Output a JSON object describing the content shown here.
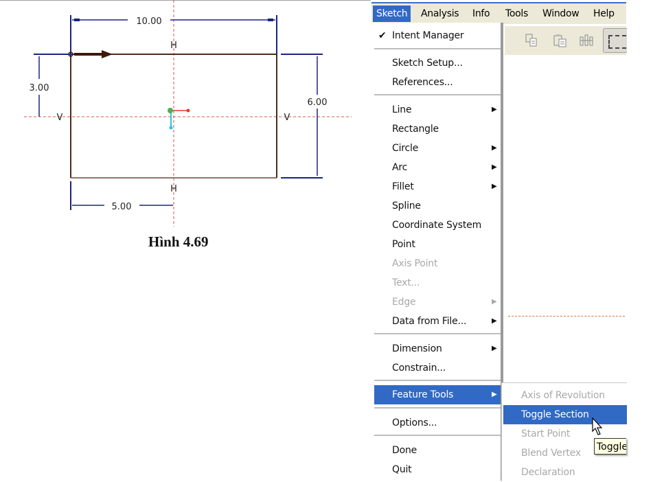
{
  "figure": {
    "caption": "Hình 4.69",
    "dimensions": {
      "top_width": "10.00",
      "left_offset": "3.00",
      "right_height": "6.00",
      "bottom_offset": "5.00"
    },
    "constraint_labels": {
      "h_top": "H",
      "h_bottom": "H",
      "v_left": "V",
      "v_right": "V"
    },
    "colors": {
      "dimension": "#1a237e",
      "geometry": "#4a2a1a",
      "centerline": "#d9534f",
      "coord_x": "#e53935",
      "coord_y": "#26c6da",
      "coord_origin": "#4caf50"
    }
  },
  "menubar": {
    "items": [
      {
        "label": "Sketch",
        "active": true
      },
      {
        "label": "Analysis"
      },
      {
        "label": "Info"
      },
      {
        "label": "Tools"
      },
      {
        "label": "Window"
      },
      {
        "label": "Help"
      }
    ]
  },
  "toolbar": {
    "icons": [
      "copy-icon",
      "paste-icon",
      "paste-special-icon",
      "select-box-icon"
    ]
  },
  "sketch_menu": {
    "items": [
      {
        "label": "Intent Manager",
        "checked": true
      },
      {
        "label": "Sketch Setup..."
      },
      {
        "label": "References..."
      },
      {
        "label": "Line",
        "submenu": true
      },
      {
        "label": "Rectangle"
      },
      {
        "label": "Circle",
        "submenu": true
      },
      {
        "label": "Arc",
        "submenu": true
      },
      {
        "label": "Fillet",
        "submenu": true
      },
      {
        "label": "Spline"
      },
      {
        "label": "Coordinate System"
      },
      {
        "label": "Point"
      },
      {
        "label": "Axis Point",
        "disabled": true
      },
      {
        "label": "Text...",
        "disabled": true
      },
      {
        "label": "Edge",
        "disabled": true,
        "submenu": true
      },
      {
        "label": "Data from File...",
        "submenu": true
      },
      {
        "label": "Dimension",
        "submenu": true
      },
      {
        "label": "Constrain..."
      },
      {
        "label": "Feature Tools",
        "submenu": true,
        "highlighted": true
      },
      {
        "label": "Options..."
      },
      {
        "label": "Done"
      },
      {
        "label": "Quit"
      }
    ]
  },
  "feature_tools_submenu": {
    "items": [
      {
        "label": "Axis of Revolution",
        "disabled": true
      },
      {
        "label": "Toggle Section",
        "highlighted": true
      },
      {
        "label": "Start Point",
        "disabled": true
      },
      {
        "label": "Blend Vertex",
        "disabled": true
      },
      {
        "label": "Declaration",
        "disabled": true
      }
    ]
  },
  "tooltip": {
    "text": "Toggle Section"
  }
}
